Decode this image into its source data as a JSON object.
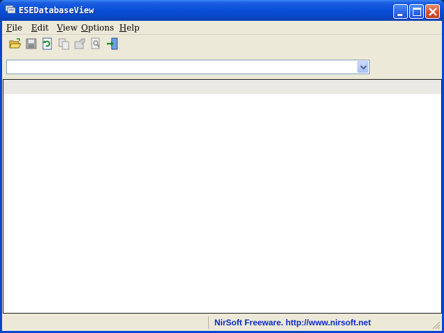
{
  "window": {
    "title": "ESEDatabaseView"
  },
  "menu": {
    "items": [
      {
        "accel": "F",
        "rest": "ile"
      },
      {
        "accel": "E",
        "rest": "dit"
      },
      {
        "accel": "V",
        "rest": "iew"
      },
      {
        "accel": "O",
        "rest": "ptions"
      },
      {
        "accel": "H",
        "rest": "elp"
      }
    ]
  },
  "toolbar": {
    "icons": [
      "open-folder-icon",
      "save-icon",
      "refresh-icon",
      "copy-icon",
      "properties-icon",
      "find-icon",
      "exit-icon"
    ]
  },
  "table_combo": {
    "value": ""
  },
  "status": {
    "left": "",
    "link": "NirSoft Freeware.  http://www.nirsoft.net"
  },
  "colors": {
    "titlebar": "#0a4fd8",
    "link": "#0a28c8",
    "client_bg": "#ece9d8"
  }
}
